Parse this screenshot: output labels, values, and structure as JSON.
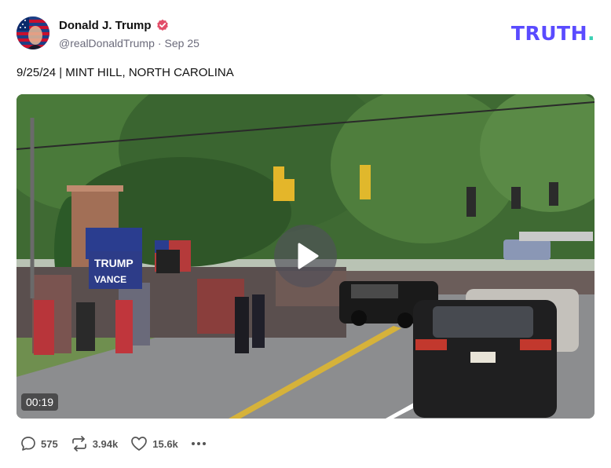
{
  "author": {
    "display_name": "Donald J. Trump",
    "handle": "@realDonaldTrump",
    "separator": "·",
    "date": "Sep 25",
    "verified": true,
    "avatar_icon": "flag-portrait-avatar"
  },
  "brand": {
    "name": "TRUTH",
    "dot": ".",
    "color": "#5a4bff",
    "dot_color": "#3ad0b4"
  },
  "post": {
    "text": "9/25/24 | MINT HILL, NORTH CAROLINA"
  },
  "video": {
    "duration": "00:19",
    "play_icon": "play-icon",
    "scene_signs": [
      "TRUMP",
      "VANCE"
    ]
  },
  "actions": {
    "replies": "575",
    "reposts": "3.94k",
    "likes": "15.6k",
    "reply_icon": "reply-icon",
    "repost_icon": "repost-icon",
    "like_icon": "heart-icon",
    "more_icon": "more-icon"
  }
}
